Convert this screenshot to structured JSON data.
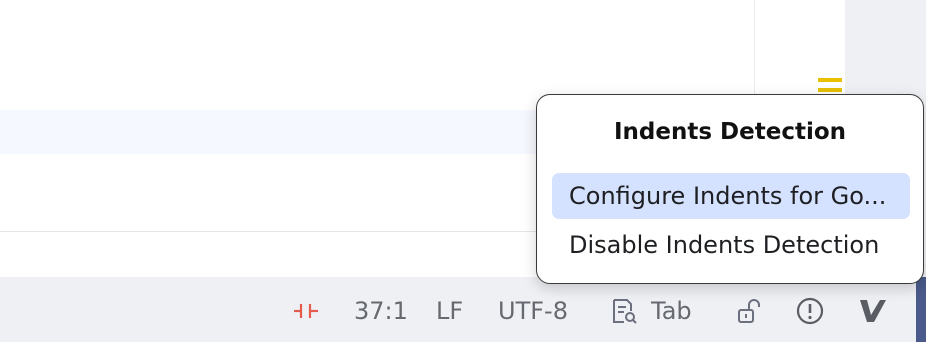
{
  "popup": {
    "title": "Indents Detection",
    "items": [
      {
        "label": "Configure Indents for Go...",
        "selected": true
      },
      {
        "label": "Disable Indents Detection",
        "selected": false
      }
    ]
  },
  "statusbar": {
    "position": "37:1",
    "line_separator": "LF",
    "encoding": "UTF-8",
    "indent": "Tab"
  },
  "icons": {
    "breakpoint": "mute-breakpoints-icon",
    "indent": "document-search-icon",
    "lock": "unlock-icon",
    "inspections": "warning-circle-icon",
    "plugin": "v-plugin-icon"
  },
  "colors": {
    "accent_selection": "#d4e2ff",
    "marker": "#e8c000",
    "breakpoint": "#e55b4d"
  }
}
